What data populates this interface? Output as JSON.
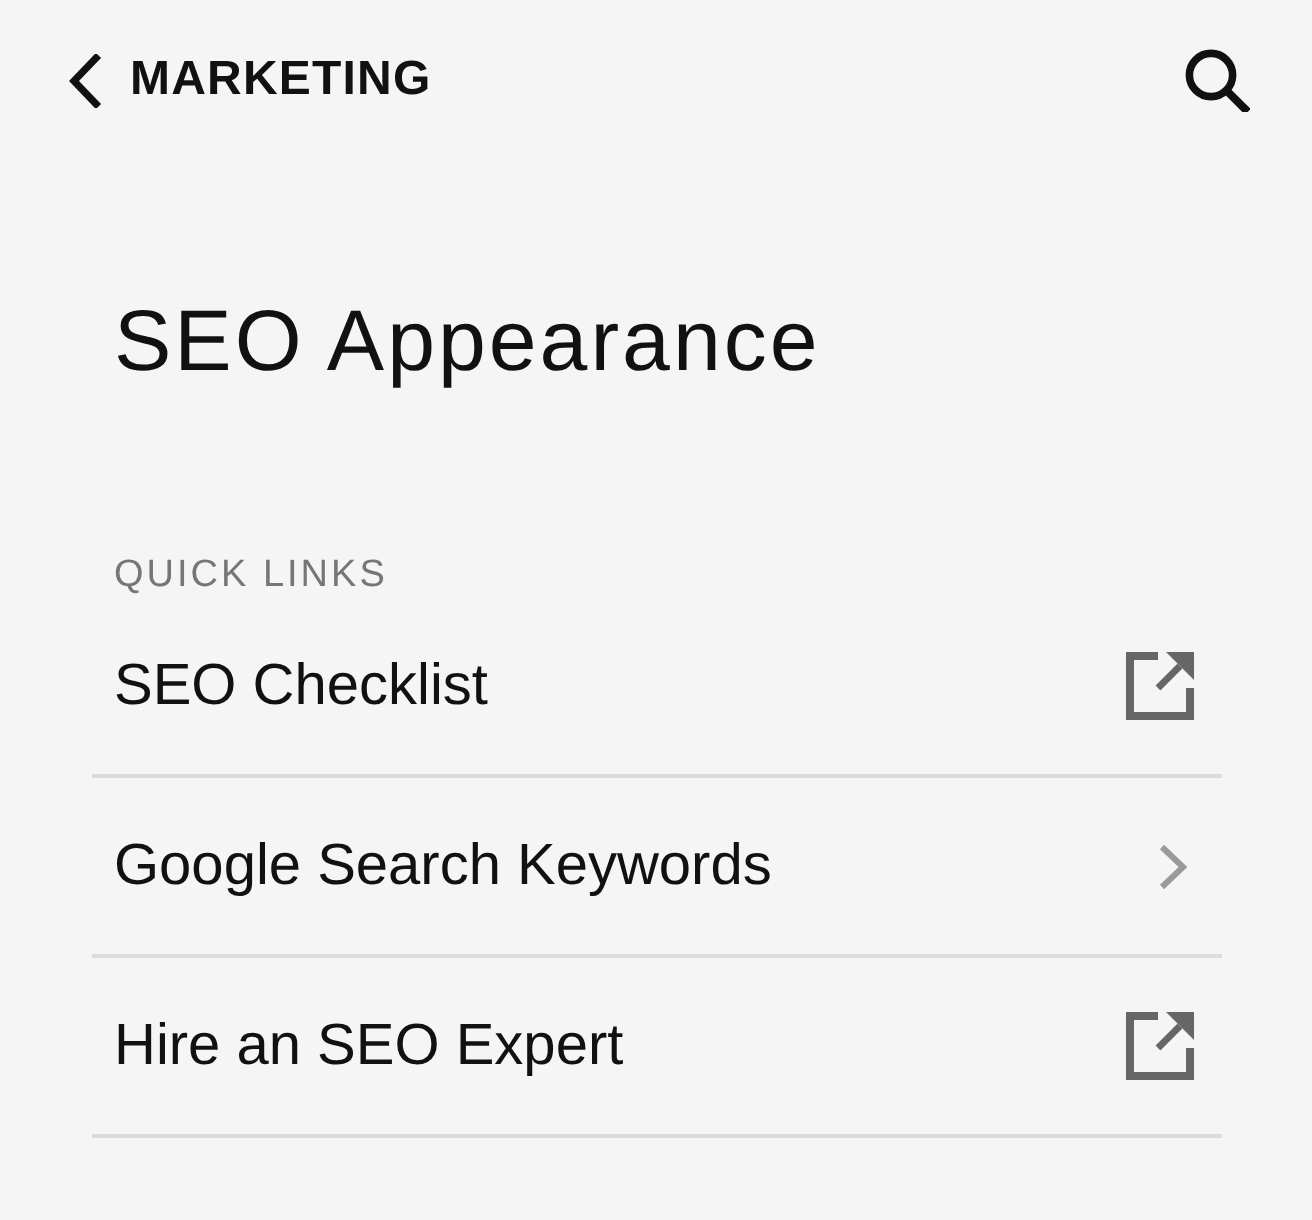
{
  "header": {
    "back_label": "MARKETING"
  },
  "title": "SEO Appearance",
  "quick_links": {
    "heading": "QUICK LINKS",
    "items": [
      {
        "label": "SEO Checklist",
        "kind": "external"
      },
      {
        "label": "Google Search Keywords",
        "kind": "navigate"
      },
      {
        "label": "Hire an SEO Expert",
        "kind": "external"
      }
    ]
  }
}
